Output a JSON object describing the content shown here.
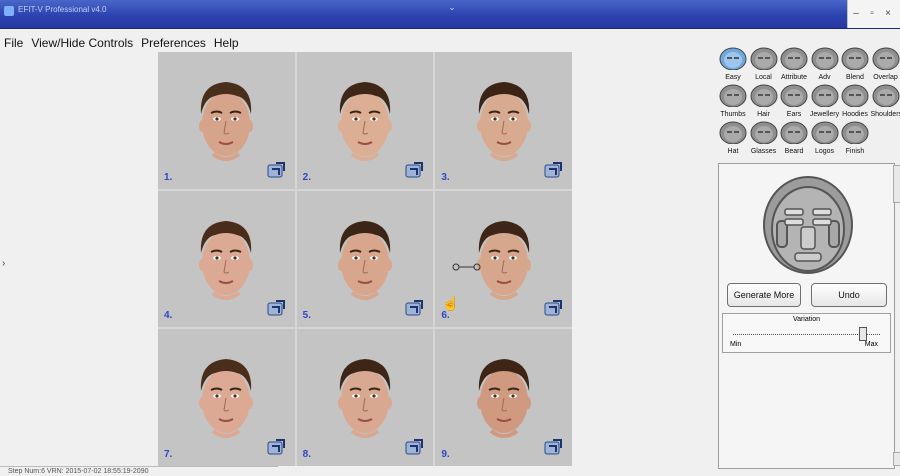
{
  "window": {
    "title": "EFIT-V Professional v4.0",
    "controls": [
      "–",
      "▫",
      "×"
    ]
  },
  "menu": [
    "File",
    "View/Hide Controls",
    "Preferences",
    "Help"
  ],
  "faces": [
    {
      "number": "1.",
      "skin": "#d6a48a",
      "hair": "#4a2e1c"
    },
    {
      "number": "2.",
      "skin": "#dcae94",
      "hair": "#3f2717"
    },
    {
      "number": "3.",
      "skin": "#d8aa90",
      "hair": "#3b2416"
    },
    {
      "number": "4.",
      "skin": "#dcaa94",
      "hair": "#4a2c1a"
    },
    {
      "number": "5.",
      "skin": "#d7a68c",
      "hair": "#3a2516"
    },
    {
      "number": "6.",
      "skin": "#d6a78d",
      "hair": "#3d2517"
    },
    {
      "number": "7.",
      "skin": "#dca994",
      "hair": "#4b2d1c"
    },
    {
      "number": "8.",
      "skin": "#d8a891",
      "hair": "#3d2618"
    },
    {
      "number": "9.",
      "skin": "#cf9a80",
      "hair": "#3e2516"
    }
  ],
  "tools": [
    {
      "label": "Easy",
      "icon": "easy-icon",
      "active": true
    },
    {
      "label": "Local",
      "icon": "local-icon"
    },
    {
      "label": "Attribute",
      "icon": "attribute-icon"
    },
    {
      "label": "Adv",
      "icon": "adv-icon"
    },
    {
      "label": "Blend",
      "icon": "blend-icon"
    },
    {
      "label": "Overlap",
      "icon": "overlap-icon"
    },
    {
      "label": "Thumbs",
      "icon": "thumbs-icon"
    },
    {
      "label": "Hair",
      "icon": "hair-icon"
    },
    {
      "label": "Ears",
      "icon": "ears-icon"
    },
    {
      "label": "Jewellery",
      "icon": "jewellery-icon"
    },
    {
      "label": "Hoodies",
      "icon": "hoodies-icon"
    },
    {
      "label": "Shoulders",
      "icon": "shoulders-icon"
    },
    {
      "label": "Hat",
      "icon": "hat-icon"
    },
    {
      "label": "Glasses",
      "icon": "glasses-icon"
    },
    {
      "label": "Beard",
      "icon": "beard-icon"
    },
    {
      "label": "Logos",
      "icon": "logos-icon"
    },
    {
      "label": "Finish",
      "icon": "finish-icon"
    }
  ],
  "panel": {
    "generate_more": "Generate More",
    "undo": "Undo",
    "variation_title": "Variation",
    "variation_min": "Min",
    "variation_max": "Max",
    "variation_value": 0.88
  },
  "status": {
    "text": "Step Num:6     VRN: 2015-07-02 18:55:19-2090"
  },
  "colors": {
    "titlebar": "#2d43b0",
    "number": "#2d47c8",
    "cell_bg": "#c4c4c4"
  }
}
